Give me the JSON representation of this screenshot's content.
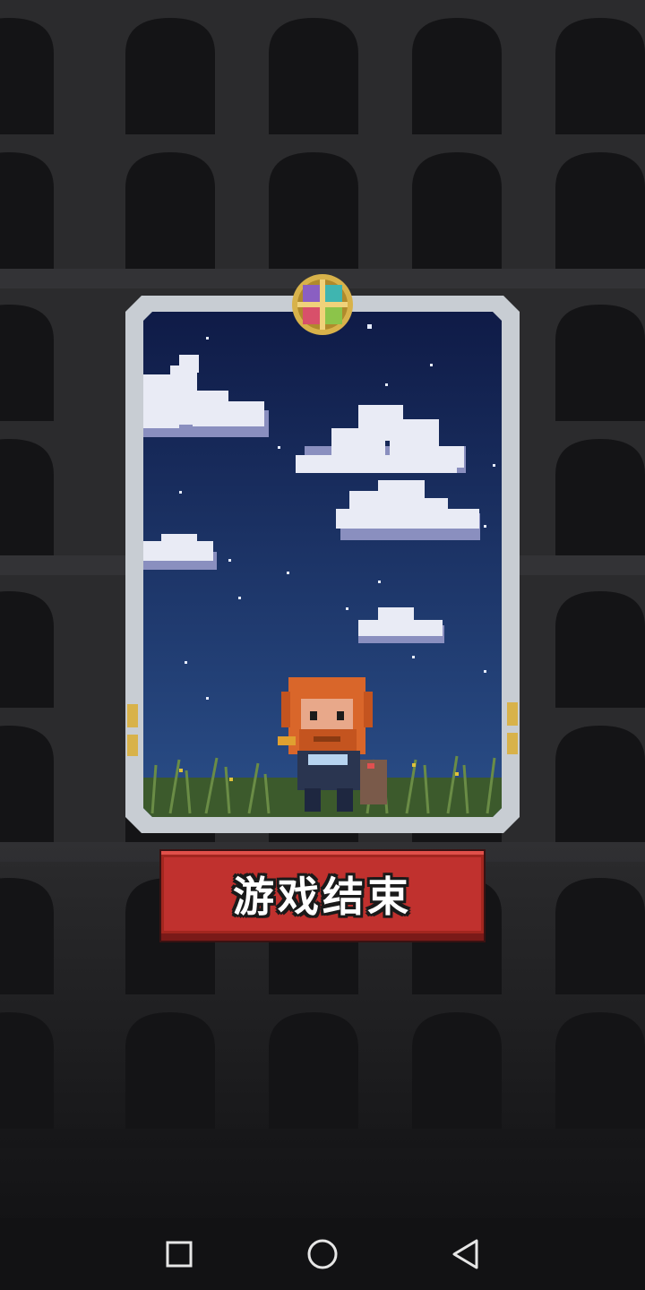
{
  "game": {
    "status_button_label": "游戏结束"
  },
  "colors": {
    "background": "#2a2a2c",
    "sky_top": "#0f1b47",
    "sky_bottom": "#2a4e88",
    "card_frame": "#c8cdd3",
    "button_red": "#c0312e",
    "hair": "#d9662a"
  },
  "icons": {
    "emblem": "compass-emblem-icon",
    "hero": "bearded-warrior-character",
    "nav_recent": "square-recent-apps-icon",
    "nav_home": "circle-home-icon",
    "nav_back": "triangle-back-icon"
  }
}
